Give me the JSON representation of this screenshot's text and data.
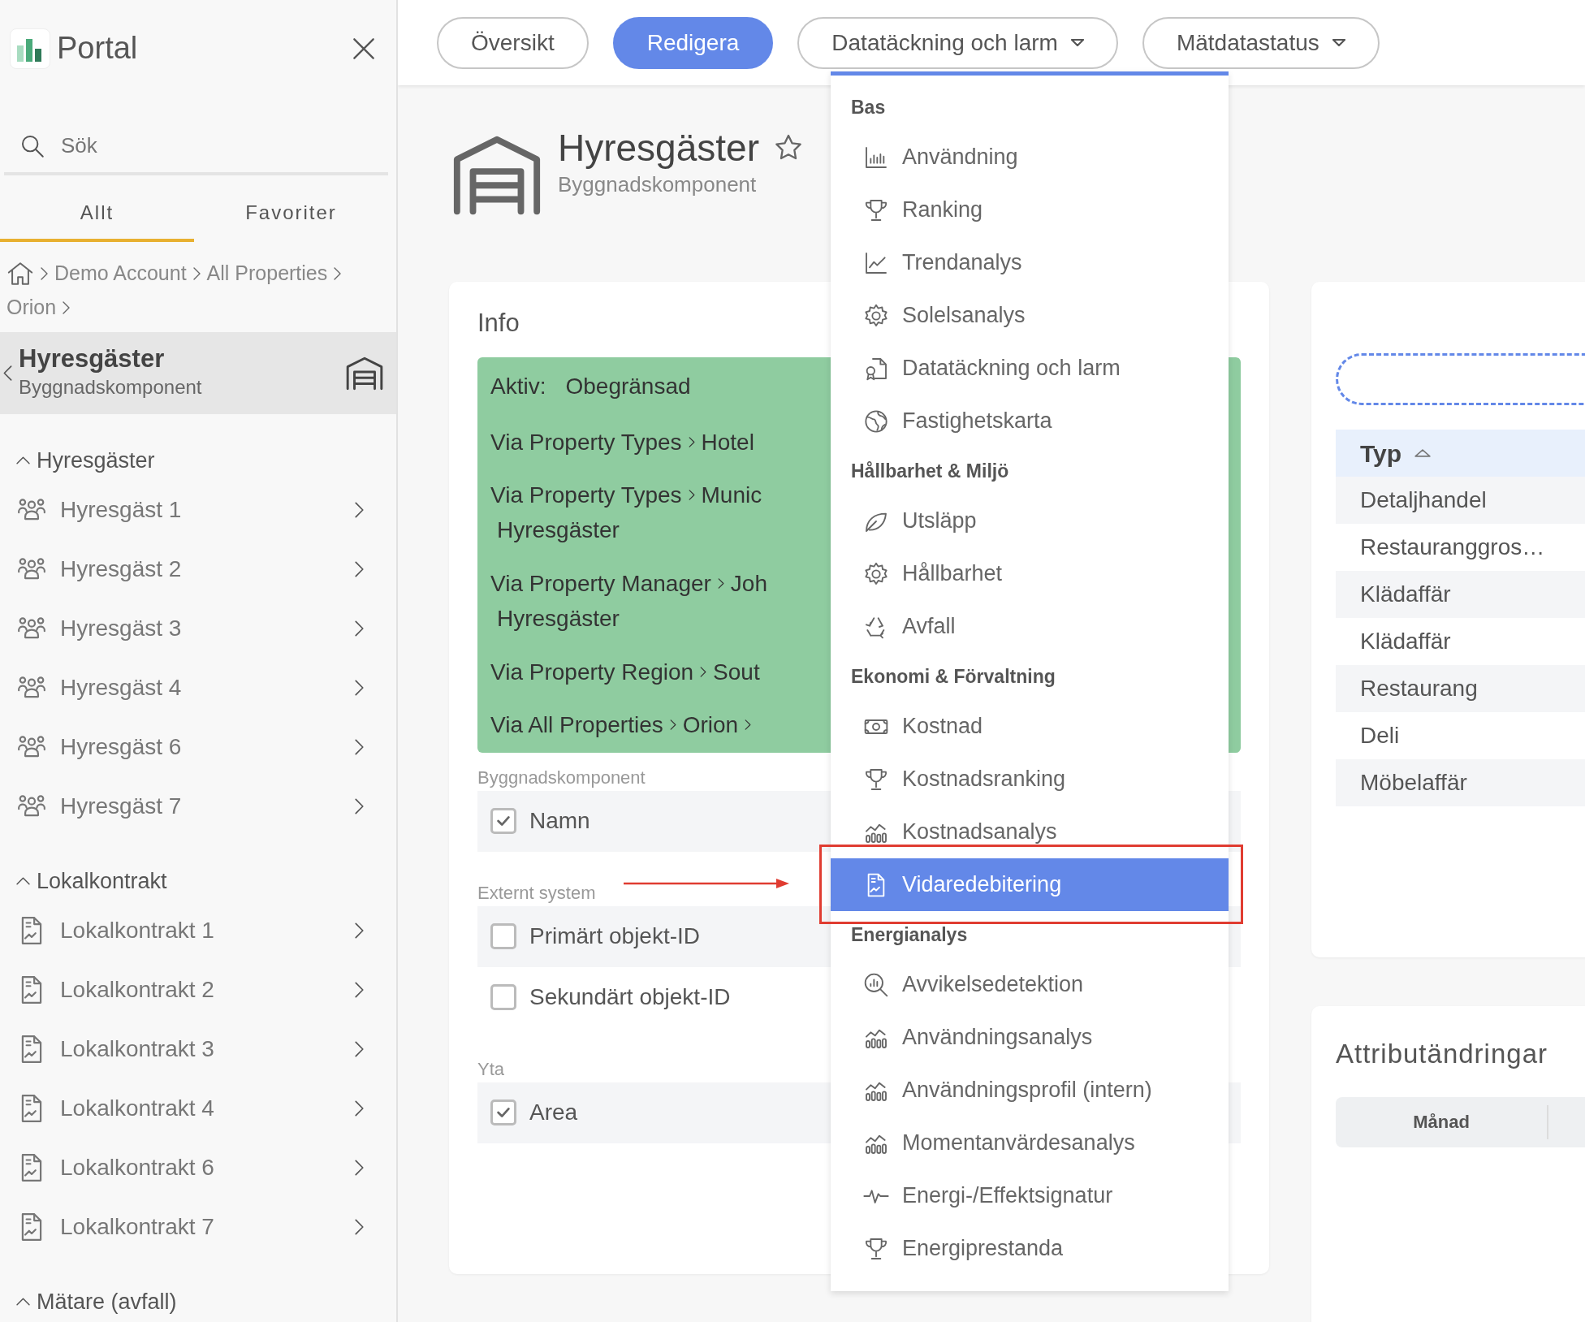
{
  "app": {
    "name": "Portal"
  },
  "search": {
    "placeholder": "Sök"
  },
  "sidebar_tabs": [
    {
      "label": "Allt",
      "selected": true
    },
    {
      "label": "Favoriter",
      "selected": false
    }
  ],
  "breadcrumb": [
    "Demo Account",
    "All Properties",
    "Orion"
  ],
  "current": {
    "title": "Hyresgäster",
    "subtitle": "Byggnadskomponent"
  },
  "groups": [
    {
      "title": "Hyresgäster",
      "kind": "tenant",
      "expanded": true,
      "items": [
        "Hyresgäst 1",
        "Hyresgäst 2",
        "Hyresgäst 3",
        "Hyresgäst 4",
        "Hyresgäst 6",
        "Hyresgäst 7"
      ]
    },
    {
      "title": "Lokalkontrakt",
      "kind": "contract",
      "expanded": true,
      "items": [
        "Lokalkontrakt 1",
        "Lokalkontrakt 2",
        "Lokalkontrakt 3",
        "Lokalkontrakt 4",
        "Lokalkontrakt 6",
        "Lokalkontrakt 7"
      ]
    },
    {
      "title": "Mätare (avfall)",
      "expanded": true
    }
  ],
  "top_tabs": [
    {
      "label": "Översikt",
      "selected": false,
      "kind": "button"
    },
    {
      "label": "Redigera",
      "selected": true,
      "kind": "button"
    },
    {
      "label": "Datatäckning och larm",
      "selected": false,
      "kind": "dropdown"
    },
    {
      "label": "Mätdatastatus",
      "selected": false,
      "kind": "dropdown"
    }
  ],
  "page": {
    "title": "Hyresgäster",
    "subtitle": "Byggnadskomponent",
    "favorite": false
  },
  "info": {
    "title": "Info",
    "active_label": "Aktiv:",
    "active_value": "Obegränsad",
    "paths": [
      {
        "via": "Via Property Types",
        "target": "Hotel",
        "more": false
      },
      {
        "via": "Via Property Types",
        "target": "Munic",
        "sub": "Hyresgäster",
        "more": false
      },
      {
        "via": "Via Property Manager",
        "target": "Joh",
        "sub": "Hyresgäster",
        "more": false
      },
      {
        "via": "Via Property Region",
        "target": "Sout",
        "more": false
      },
      {
        "via": "Via All Properties",
        "target": "Orion",
        "more": true
      }
    ],
    "sections": [
      {
        "label": "Byggnadskomponent",
        "fields": [
          {
            "label": "Namn",
            "checked": true
          }
        ]
      },
      {
        "label": "Externt system",
        "fields": [
          {
            "label": "Primärt objekt-ID",
            "checked": false
          },
          {
            "label": "Sekundärt objekt-ID",
            "checked": false
          }
        ]
      },
      {
        "label": "Yta",
        "fields": [
          {
            "label": "Area",
            "checked": true
          }
        ]
      }
    ]
  },
  "menu": {
    "sections": [
      {
        "title": "Bas",
        "items": [
          {
            "label": "Användning",
            "kind": "bars",
            "selected": false
          },
          {
            "label": "Ranking",
            "kind": "trophy",
            "selected": false
          },
          {
            "label": "Trendanalys",
            "kind": "line",
            "selected": false
          },
          {
            "label": "Solelsanalys",
            "kind": "sun",
            "selected": false
          },
          {
            "label": "Datatäckning och larm",
            "kind": "certificate",
            "selected": false
          },
          {
            "label": "Fastighetskarta",
            "kind": "globe",
            "selected": false
          }
        ]
      },
      {
        "title": "Hållbarhet & Miljö",
        "items": [
          {
            "label": "Utsläpp",
            "kind": "leaf",
            "selected": false
          },
          {
            "label": "Hållbarhet",
            "kind": "sun",
            "selected": false
          },
          {
            "label": "Avfall",
            "kind": "recycle",
            "selected": false
          }
        ]
      },
      {
        "title": "Ekonomi & Förvaltning",
        "items": [
          {
            "label": "Kostnad",
            "kind": "money",
            "selected": false
          },
          {
            "label": "Kostnadsranking",
            "kind": "trophy",
            "selected": false
          },
          {
            "label": "Kostnadsanalys",
            "kind": "analysis",
            "selected": false
          },
          {
            "label": "Vidaredebitering",
            "kind": "document",
            "selected": true
          }
        ]
      },
      {
        "title": "Energianalys",
        "items": [
          {
            "label": "Avvikelsedetektion",
            "kind": "inspect",
            "selected": false
          },
          {
            "label": "Användningsanalys",
            "kind": "analysis",
            "selected": false
          },
          {
            "label": "Användningsprofil (intern)",
            "kind": "analysis",
            "selected": false
          },
          {
            "label": "Momentanvärdesanalys",
            "kind": "analysis",
            "selected": false
          },
          {
            "label": "Energi-/Effektsignatur",
            "kind": "pulse",
            "selected": false
          },
          {
            "label": "Energiprestanda",
            "kind": "trophy",
            "selected": false
          }
        ]
      }
    ]
  },
  "types_table": {
    "columns": [
      {
        "label": "Typ",
        "sorted": true
      }
    ],
    "rows": [
      "Detaljhandel",
      "Restauranggros…",
      "Klädaffär",
      "Klädaffär",
      "Restaurang",
      "Deli",
      "Möbelaffär"
    ]
  },
  "attribute_changes": {
    "title": "Attributändringar",
    "columns": [
      "Månad"
    ]
  }
}
